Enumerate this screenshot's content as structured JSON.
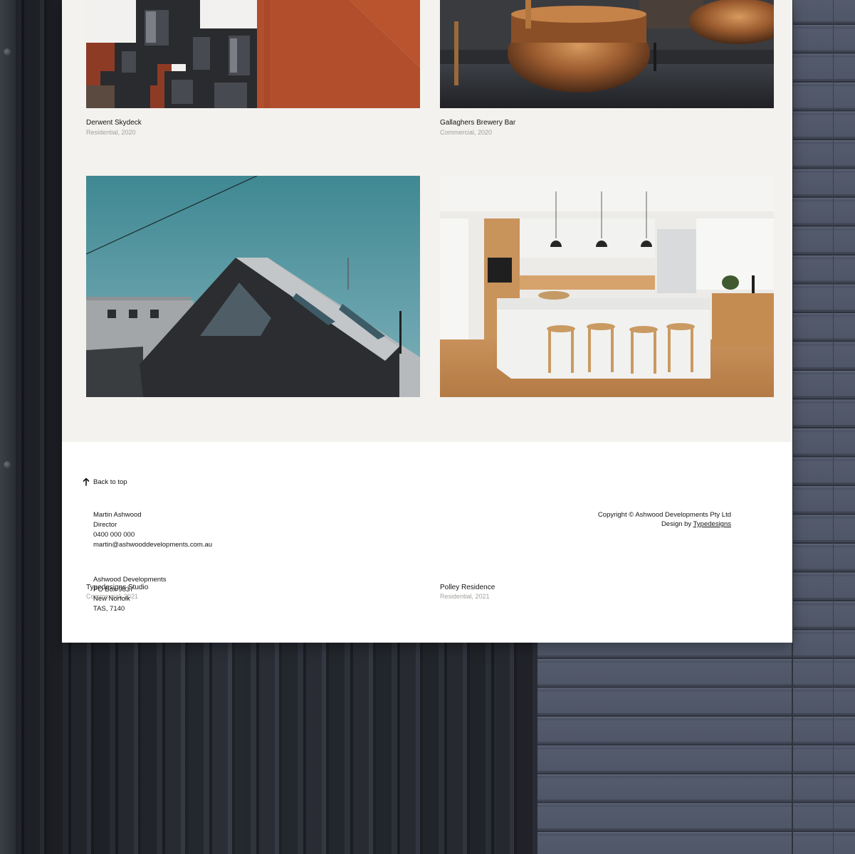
{
  "projects": [
    {
      "title": "Derwent Skydeck",
      "meta": "Residential, 2020",
      "image": "apartment-building-photo"
    },
    {
      "title": "Gallaghers Brewery Bar",
      "meta": "Commercial, 2020",
      "image": "brewery-copper-kettle-photo"
    },
    {
      "title": "Typedesigns Studio",
      "meta": "Commercial, 2021",
      "image": "black-timber-house-photo"
    },
    {
      "title": "Polley Residence",
      "meta": "Residential, 2021",
      "image": "kitchen-interior-photo"
    }
  ],
  "footer": {
    "back_to_top": "Back to top",
    "contact": {
      "name": "Martin Ashwood",
      "role": "Director",
      "phone": "0400 000 000",
      "email": "martin@ashwooddevelopments.com.au"
    },
    "address": {
      "company": "Ashwood Developments",
      "po_box": "PO Box 9837",
      "town": "New Norfolk",
      "state_postcode": "TAS, 7140"
    },
    "copyright": "Copyright © Ashwood Developments Pty Ltd",
    "design_by_prefix": "Design by",
    "design_by_link": "Typedesigns"
  },
  "colors": {
    "grid_background": "#f3f2ef",
    "panel_background": "#ffffff",
    "text": "#141414",
    "meta_text": "#a2a09b"
  }
}
